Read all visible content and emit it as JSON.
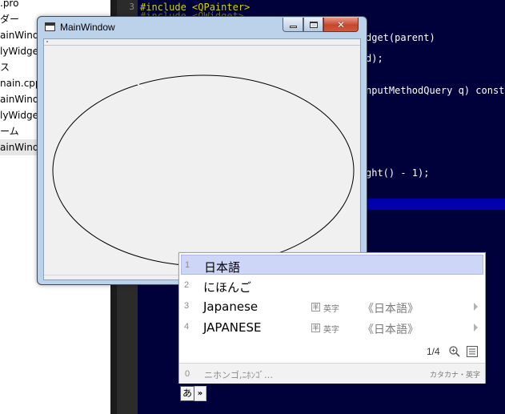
{
  "tree": {
    "items": [
      {
        "label": ".pro",
        "selected": false
      },
      {
        "label": "ダー",
        "selected": false
      },
      {
        "label": "ainWindo",
        "selected": false
      },
      {
        "label": "lyWidge",
        "selected": false
      },
      {
        "label": "ス",
        "selected": false
      },
      {
        "label": "nain.cpp",
        "selected": false
      },
      {
        "label": "ainWindo",
        "selected": false
      },
      {
        "label": "lyWidge",
        "selected": false
      },
      {
        "label": "ーム",
        "selected": false
      },
      {
        "label": "ainWindo",
        "selected": true
      }
    ]
  },
  "editor": {
    "line_number": "3",
    "line1_keyword": "#include",
    "line1_header": "<QPainter>",
    "line2_keyword": "#include",
    "line2_header": "<QWidget>",
    "frag_ctor": "dget(parent)",
    "frag_close": "d);",
    "frag_query": "nputMethodQuery q) const",
    "frag_height": "ght() - 1);"
  },
  "main_window": {
    "title": "MainWindow",
    "close_glyph": "✕"
  },
  "ime": {
    "candidates": [
      {
        "num": "1",
        "word": "日本語",
        "active": true
      },
      {
        "num": "2",
        "word": "にほんご",
        "active": false
      },
      {
        "num": "3",
        "word": "Japanese",
        "badge": "半",
        "type": "英字",
        "meaning": "《日本語》",
        "active": false
      },
      {
        "num": "4",
        "word": "JAPANESE",
        "badge": "半",
        "type": "英字",
        "meaning": "《日本語》",
        "active": false
      }
    ],
    "pager": "1/4",
    "footer_num": "0",
    "footer_text": "ニホンゴ,ﾆﾎﾝｺﾞ…",
    "footer_type": "カタカナ・英字"
  },
  "langbar": {
    "mode": "あ",
    "expand": "»"
  },
  "colors": {
    "editor_bg": "#00003b",
    "current_line": "#0000ae",
    "candidate_highlight": "#cdd6f6"
  }
}
